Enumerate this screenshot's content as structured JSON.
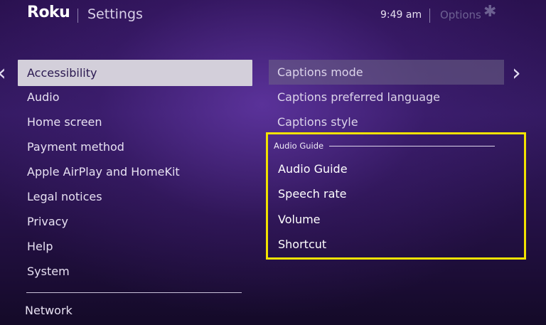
{
  "header": {
    "logo": "Roku",
    "title": "Settings",
    "time": "9:49 am",
    "options_label": "Options",
    "options_icon": "asterisk-icon"
  },
  "nav": {
    "left_arrow": "‹",
    "right_arrow": "›"
  },
  "left_menu": {
    "selected_index": 0,
    "items": [
      "Accessibility",
      "Audio",
      "Home screen",
      "Payment method",
      "Apple AirPlay and HomeKit",
      "Legal notices",
      "Privacy",
      "Help",
      "System"
    ],
    "bottom_item": "Network"
  },
  "right_menu": {
    "items": [
      "Captions mode",
      "Captions preferred language",
      "Captions style"
    ],
    "section": {
      "header": "Audio Guide",
      "items": [
        "Audio Guide",
        "Speech rate",
        "Volume",
        "Shortcut"
      ]
    }
  },
  "colors": {
    "background": "#2a1150",
    "selected_item": "#d3cfda",
    "highlight_box": "#f2e200"
  }
}
